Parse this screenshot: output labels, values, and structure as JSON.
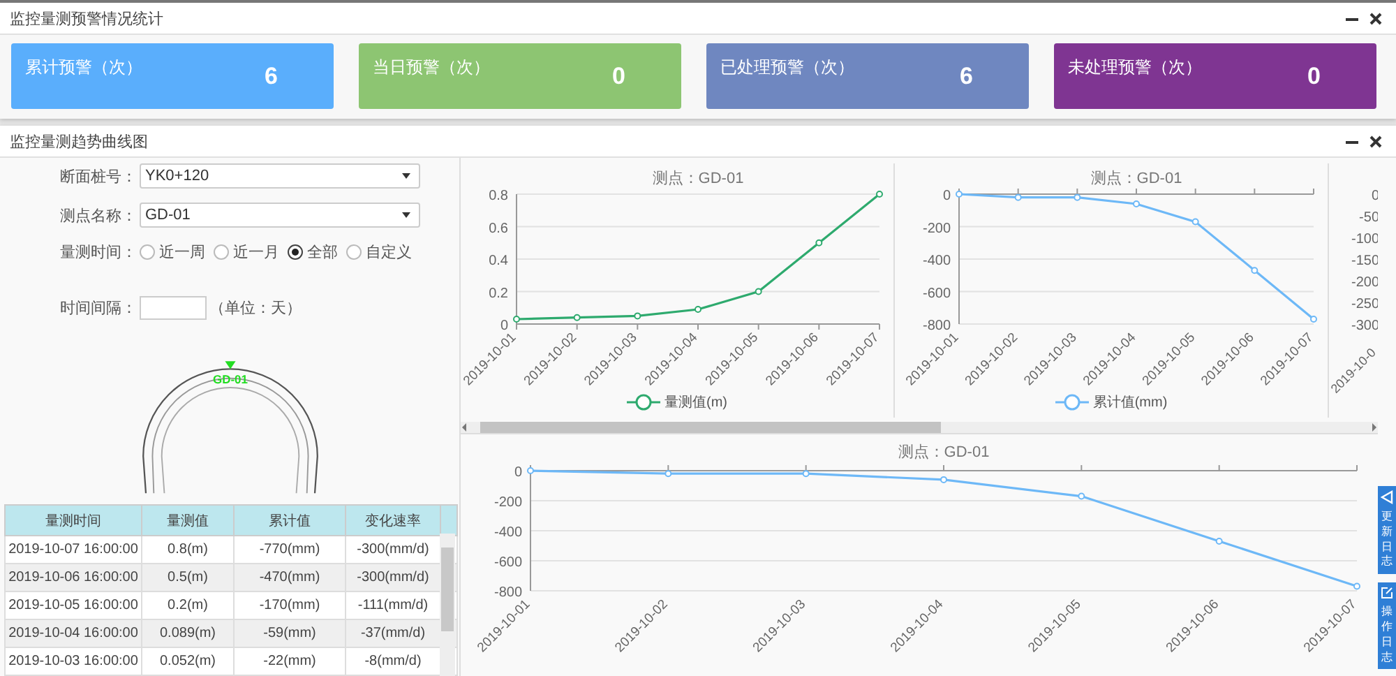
{
  "stats_panel": {
    "title": "监控量测预警情况统计",
    "cards": [
      {
        "label": "累计预警（次）",
        "count": "6",
        "color": "#5aaefc"
      },
      {
        "label": "当日预警（次）",
        "count": "0",
        "color": "#8dc572"
      },
      {
        "label": "已处理预警（次）",
        "count": "6",
        "color": "#6f87c0"
      },
      {
        "label": "未处理预警（次）",
        "count": "0",
        "color": "#7f3592"
      }
    ]
  },
  "trend_panel": {
    "title": "监控量测趋势曲线图",
    "form": {
      "section": {
        "label": "断面桩号：",
        "value": "YK0+120"
      },
      "point": {
        "label": "测点名称：",
        "value": "GD-01"
      },
      "time_range": {
        "label": "量测时间：",
        "options": [
          {
            "label": "近一周",
            "selected": false
          },
          {
            "label": "近一月",
            "selected": false
          },
          {
            "label": "全部",
            "selected": true
          },
          {
            "label": "自定义",
            "selected": false
          }
        ]
      },
      "interval": {
        "label": "时间间隔：",
        "unit": "（单位：天）"
      }
    },
    "diagram": {
      "point_label": "GD-01"
    },
    "table": {
      "columns": [
        "量测时间",
        "量测值",
        "累计值",
        "变化速率"
      ],
      "rows": [
        [
          "2019-10-07 16:00:00",
          "0.8(m)",
          "-770(mm)",
          "-300(mm/d)"
        ],
        [
          "2019-10-06 16:00:00",
          "0.5(m)",
          "-470(mm)",
          "-300(mm/d)"
        ],
        [
          "2019-10-05 16:00:00",
          "0.2(m)",
          "-170(mm)",
          "-111(mm/d)"
        ],
        [
          "2019-10-04 16:00:00",
          "0.089(m)",
          "-59(mm)",
          "-37(mm/d)"
        ],
        [
          "2019-10-03 16:00:00",
          "0.052(m)",
          "-22(mm)",
          "-8(mm/d)"
        ]
      ]
    },
    "charts": [
      {
        "chart_data": {
          "type": "line",
          "title": "测点：GD-01",
          "categories": [
            "2019-10-01",
            "2019-10-02",
            "2019-10-03",
            "2019-10-04",
            "2019-10-05",
            "2019-10-06",
            "2019-10-07"
          ],
          "ylim": [
            0,
            0.8
          ],
          "yticks": [
            0,
            0.2,
            0.4,
            0.6,
            0.8
          ],
          "grid": true,
          "series": [
            {
              "name": "量测值(m)",
              "color": "#2eaa6e",
              "marker": "circle",
              "values": [
                0.03,
                0.04,
                0.05,
                0.09,
                0.2,
                0.5,
                0.8
              ]
            }
          ]
        }
      },
      {
        "chart_data": {
          "type": "line",
          "title": "测点：GD-01",
          "categories": [
            "2019-10-01",
            "2019-10-02",
            "2019-10-03",
            "2019-10-04",
            "2019-10-05",
            "2019-10-06",
            "2019-10-07"
          ],
          "ylim": [
            -800,
            0
          ],
          "yticks": [
            0,
            -200,
            -400,
            -600,
            -800
          ],
          "grid": true,
          "series": [
            {
              "name": "累计值(mm)",
              "color": "#6db8f7",
              "marker": "circle",
              "values": [
                0,
                -20,
                -20,
                -60,
                -170,
                -470,
                -770
              ]
            }
          ]
        }
      }
    ],
    "partial_chart": {
      "y_labels": [
        "0",
        "-50",
        "-100",
        "-150",
        "-200",
        "-250",
        "-300"
      ],
      "x_label": "2019-10-0"
    },
    "bottom_chart": {
      "chart_data": {
        "type": "line",
        "title": "测点：GD-01",
        "categories": [
          "2019-10-01",
          "2019-10-02",
          "2019-10-03",
          "2019-10-04",
          "2019-10-05",
          "2019-10-06",
          "2019-10-07"
        ],
        "ylim": [
          -800,
          0
        ],
        "yticks": [
          0,
          -200,
          -400,
          -600,
          -800
        ],
        "grid": true,
        "series": [
          {
            "color": "#6db8f7",
            "marker": "circle",
            "values": [
              0,
              -20,
              -20,
              -60,
              -170,
              -470,
              -770
            ]
          }
        ]
      }
    }
  },
  "side_tabs": [
    {
      "kind": "update",
      "label": "更新日志"
    },
    {
      "kind": "edit",
      "label": "操作日志"
    }
  ]
}
